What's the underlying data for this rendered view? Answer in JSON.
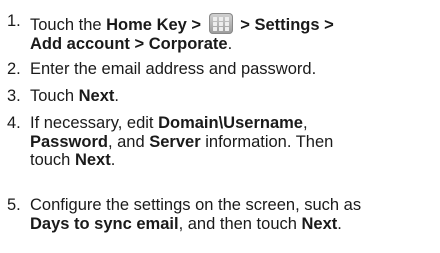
{
  "steps": [
    {
      "number": "1.",
      "line1": [
        "Touch the ",
        "Home Key > ",
        " > Settings >"
      ],
      "line2": "Add account > Corporate",
      "line2_end": ".",
      "icon": "apps-grid-icon"
    },
    {
      "number": "2.",
      "text": "Enter the email address and password."
    },
    {
      "number": "3.",
      "pre": "Touch ",
      "bold": "Next",
      "post": "."
    },
    {
      "number": "4.",
      "line1": [
        "If necessary, edit ",
        "Domain\\Username",
        ","
      ],
      "line2": [
        "Password",
        ", and ",
        "Server",
        " information. Then"
      ],
      "line3": [
        "touch ",
        "Next",
        "."
      ]
    },
    {
      "number": "5.",
      "line1": "Configure the settings on the screen, such as",
      "line2": [
        "Days to sync email",
        ", and then touch ",
        "Next",
        "."
      ]
    }
  ]
}
